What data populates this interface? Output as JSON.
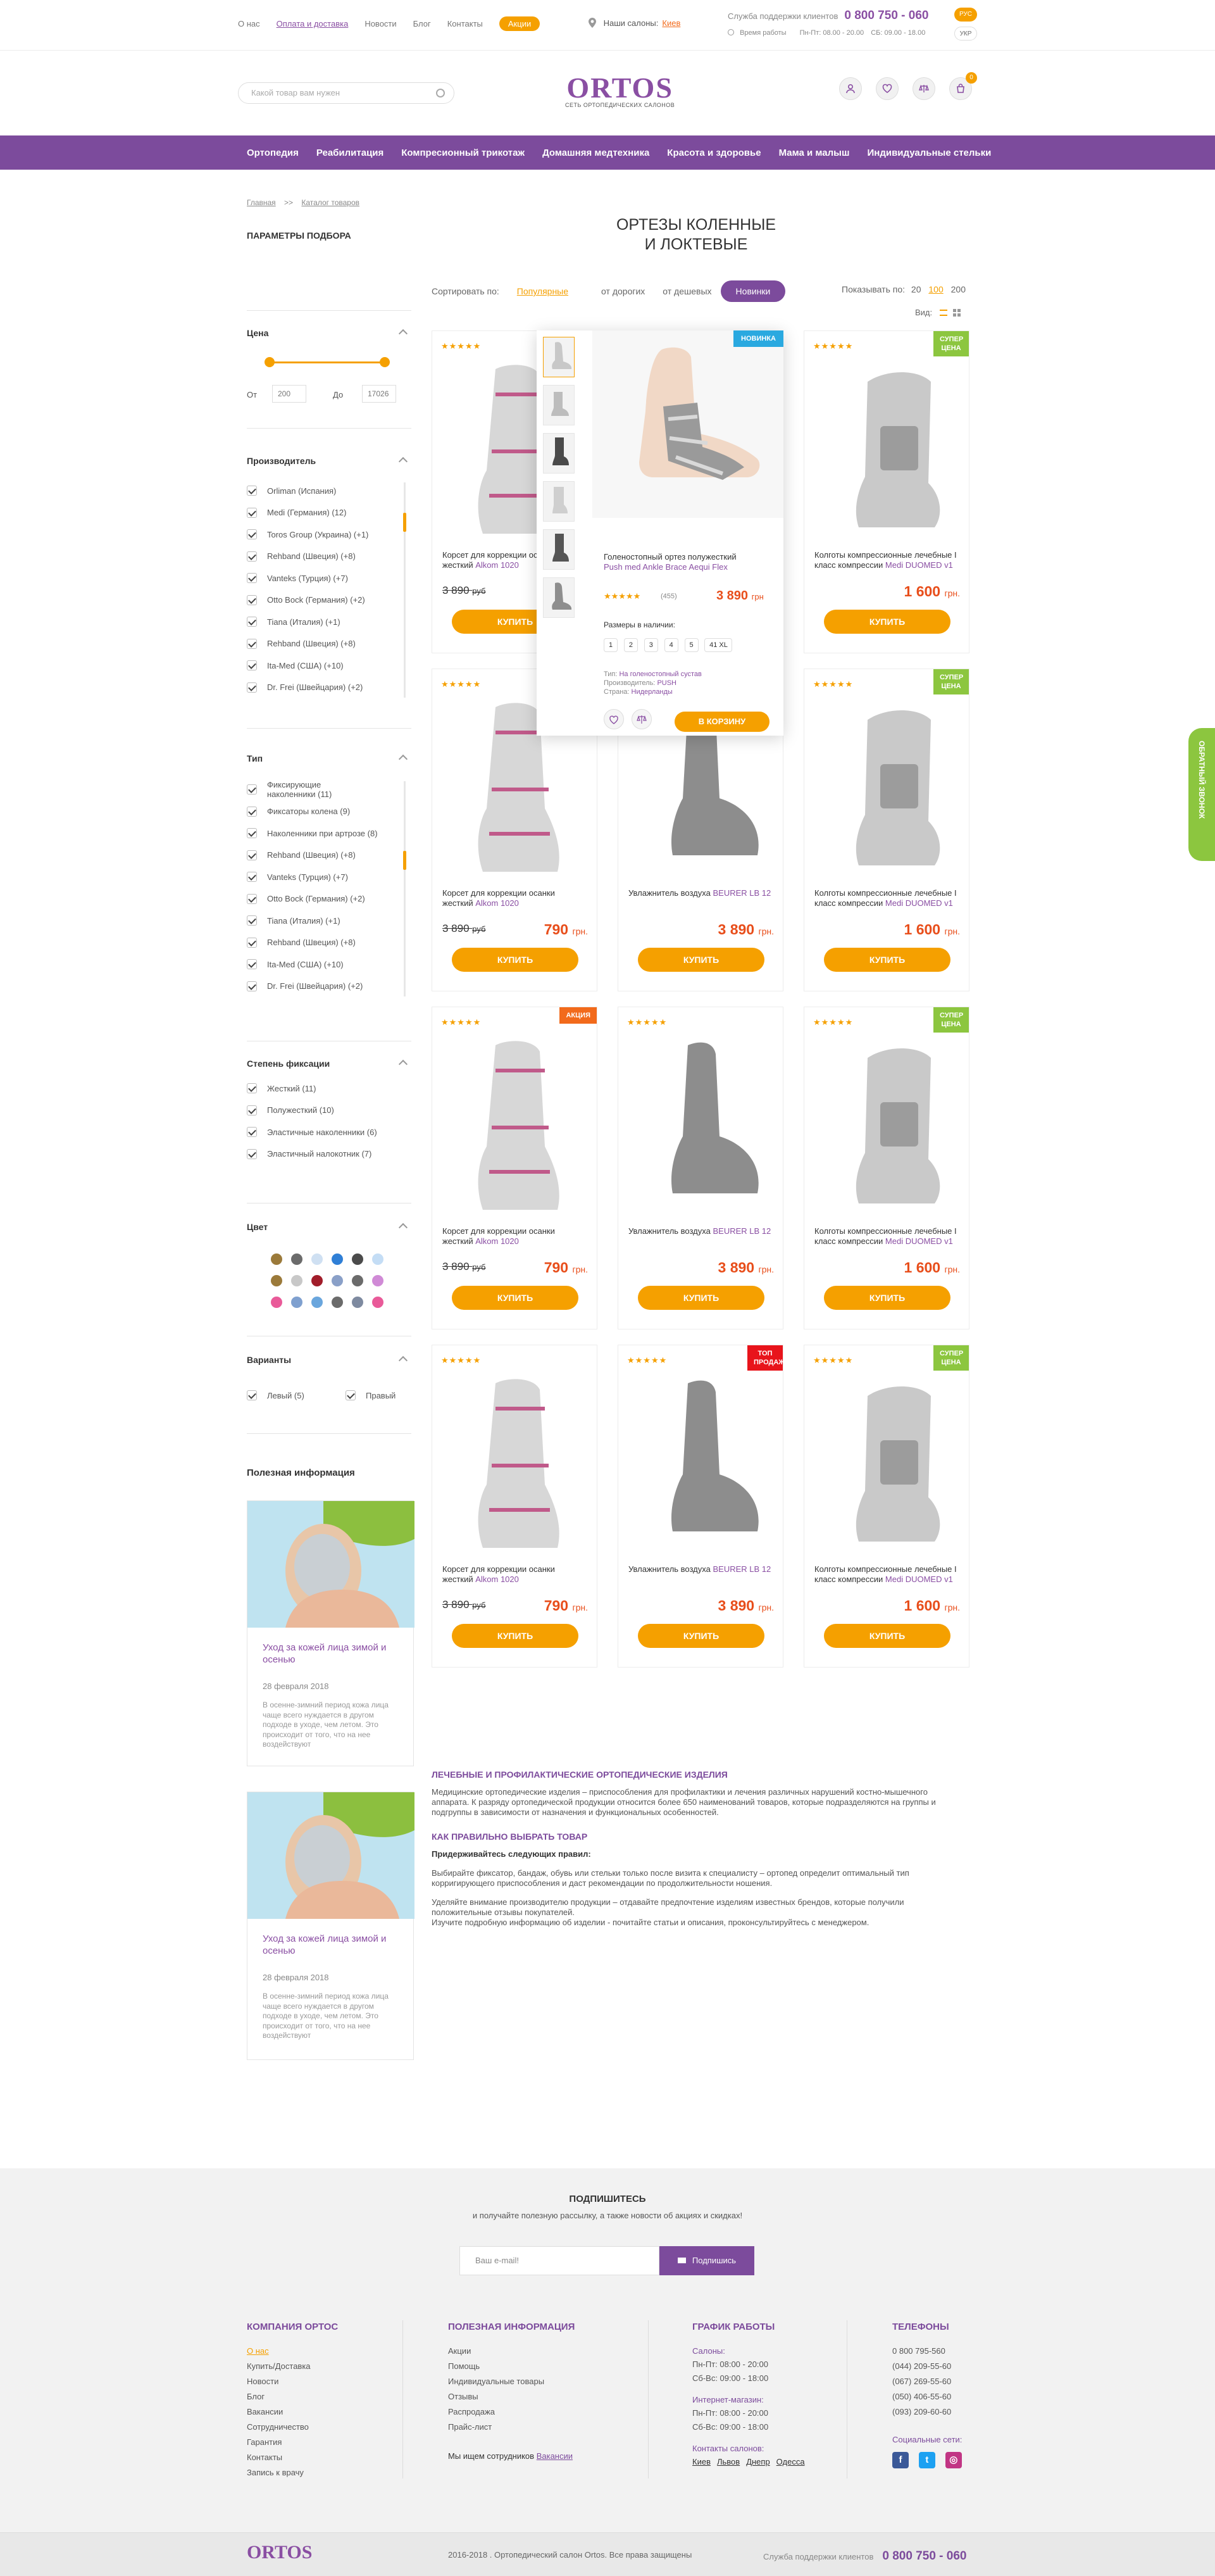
{
  "topnav": {
    "items": [
      "О нас",
      "Оплата и доставка",
      "Новости",
      "Блог",
      "Контакты"
    ],
    "promo": "Акции"
  },
  "salons": {
    "label": "Наши салоны:",
    "city": "Киев"
  },
  "support": {
    "label": "Служба поддержки клиентов",
    "phone": "0 800 750 - 060",
    "hours_label": "Время работы",
    "hours_weekday": "Пн-Пт: 08.00 - 20.00",
    "hours_sat": "СБ: 09.00 - 18.00",
    "lang_ru": "РУС",
    "lang_ua": "УКР"
  },
  "header": {
    "search_placeholder": "Какой товар вам нужен",
    "logo": "ORTOS",
    "logo_tagline": "СЕТЬ ОРТОПЕДИЧЕСКИХ САЛОНОВ",
    "cart_count": "0"
  },
  "mainnav": [
    "Ортопедия",
    "Реабилитация",
    "Компресионный трикотаж",
    "Домашняя медтехника",
    "Красота и здоровье",
    "Мама и малыш",
    "Индивидуальные стельки"
  ],
  "breadcrumbs": {
    "home": "Главная",
    "sep": ">>",
    "current": "Каталог товаров"
  },
  "filters": {
    "title": "ПАРАМЕТРЫ ПОДБОРА",
    "price": {
      "title": "Цена",
      "from_label": "От",
      "from": "200",
      "to_label": "До",
      "to": "17026"
    },
    "maker": {
      "title": "Производитель",
      "items": [
        "Orliman (Испания)",
        "Medi (Германия)  (12)",
        "Toros Group (Украина) (+1)",
        "Rehband (Швеция) (+8)",
        "Vanteks (Турция) (+7)",
        "Otto Bock (Германия) (+2)",
        "Tiana (Италия) (+1)",
        "Rehband (Швеция) (+8)",
        "Ita-Med (США) (+10)",
        "Dr. Frei (Швейцария) (+2)"
      ]
    },
    "type": {
      "title": "Тип",
      "items": [
        "Фиксирующие наколенники (11)",
        "Фиксаторы колена (9)",
        "Наколенники при артрозе (8)",
        "Rehband (Швеция) (+8)",
        "Vanteks (Турция) (+7)",
        "Otto Bock (Германия) (+2)",
        "Tiana (Италия) (+1)",
        "Rehband (Швеция) (+8)",
        "Ita-Med (США) (+10)",
        "Dr. Frei (Швейцария) (+2)"
      ]
    },
    "fixation": {
      "title": "Степень фиксации",
      "items": [
        "Жесткий (11)",
        "Полужесткий (10)",
        "Эластичные наколенники (6)",
        "Эластичный налокотник (7)"
      ]
    },
    "color": {
      "title": "Цвет",
      "swatches": [
        "#9b7a3a",
        "#6b6b6b",
        "#cfe0f2",
        "#2f7fd6",
        "#4b4b4b",
        "#c4ddf5",
        "#9b7a3a",
        "#c8c8c8",
        "#a11d2a",
        "#8aa0c8",
        "#6b6b6b",
        "#d08ad6",
        "#e95a99",
        "#7fa0cf",
        "#6aa6dd",
        "#6b6b6b",
        "#7e8aa0",
        "#e95a99"
      ]
    },
    "variants": {
      "title": "Варианты",
      "left": "Левый (5)",
      "right": "Правый"
    }
  },
  "page": {
    "title_line1": "ОРТЕЗЫ КОЛЕННЫЕ",
    "title_line2": "И ЛОКТЕВЫЕ"
  },
  "sort": {
    "label": "Сортировать по:",
    "popular": "Популярные",
    "expensive": "от дорогих",
    "cheap": "от дешевых",
    "new": "Новинки"
  },
  "show": {
    "label": "Показывать по:",
    "opt1": "20",
    "opt2": "100",
    "opt3": "200",
    "view_label": "Вид:"
  },
  "products": [
    {
      "stars": "★★★★★",
      "badge": "",
      "name": "Корсет для коррекции осанки жесткий",
      "brand": "Alkom 1020",
      "old": "3 890",
      "oldcur": "руб",
      "price": "",
      "cur": "",
      "buy": "КУПИТЬ"
    },
    {
      "stars": "",
      "badge": "НОВИНКА",
      "name": "",
      "brand": "",
      "old": "",
      "oldcur": "",
      "price": "",
      "cur": "",
      "buy": ""
    },
    {
      "stars": "★★★★★",
      "badge": "СУПЕР ЦЕНА",
      "name": "Колготы компрессионные лечебные I класс компрессии",
      "brand": "Medi DUOMED v1",
      "old": "",
      "oldcur": "",
      "price": "1 600",
      "cur": "грн.",
      "buy": "КУПИТЬ"
    },
    {
      "stars": "★★★★★",
      "badge": "",
      "name": "Корсет для коррекции осанки жесткий",
      "brand": "Alkom 1020",
      "old": "3 890",
      "oldcur": "руб",
      "price": "790",
      "cur": "грн.",
      "buy": "КУПИТЬ"
    },
    {
      "stars": "",
      "badge": "",
      "name": "Увлажнитель воздуха",
      "brand": "BEURER LB 12",
      "old": "",
      "oldcur": "",
      "price": "3 890",
      "cur": "грн.",
      "buy": "КУПИТЬ"
    },
    {
      "stars": "★★★★★",
      "badge": "СУПЕР ЦЕНА",
      "name": "Колготы компрессионные лечебные I класс компрессии",
      "brand": "Medi DUOMED v1",
      "old": "",
      "oldcur": "",
      "price": "1 600",
      "cur": "грн.",
      "buy": "КУПИТЬ"
    },
    {
      "stars": "★★★★★",
      "badge": "АКЦИЯ",
      "name": "Корсет для коррекции осанки жесткий",
      "brand": "Alkom 1020",
      "old": "3 890",
      "oldcur": "руб",
      "price": "790",
      "cur": "грн.",
      "buy": "КУПИТЬ"
    },
    {
      "stars": "★★★★★",
      "badge": "",
      "name": "Увлажнитель воздуха",
      "brand": "BEURER LB 12",
      "old": "",
      "oldcur": "",
      "price": "3 890",
      "cur": "грн.",
      "buy": "КУПИТЬ"
    },
    {
      "stars": "★★★★★",
      "badge": "СУПЕР ЦЕНА",
      "name": "Колготы компрессионные лечебные I класс компрессии",
      "brand": "Medi DUOMED v1",
      "old": "",
      "oldcur": "",
      "price": "1 600",
      "cur": "грн.",
      "buy": "КУПИТЬ"
    },
    {
      "stars": "★★★★★",
      "badge": "",
      "name": "Корсет для коррекции осанки жесткий",
      "brand": "Alkom 1020",
      "old": "3 890",
      "oldcur": "руб",
      "price": "790",
      "cur": "грн.",
      "buy": "КУПИТЬ"
    },
    {
      "stars": "★★★★★",
      "badge": "ТОП ПРОДАЖ",
      "name": "Увлажнитель воздуха",
      "brand": "BEURER LB 12",
      "old": "",
      "oldcur": "",
      "price": "3 890",
      "cur": "грн.",
      "buy": "КУПИТЬ"
    },
    {
      "stars": "★★★★★",
      "badge": "СУПЕР ЦЕНА",
      "name": "Колготы компрессионные лечебные I класс компрессии",
      "brand": "Medi DUOMED v1",
      "old": "",
      "oldcur": "",
      "price": "1 600",
      "cur": "грн.",
      "buy": "КУПИТЬ"
    }
  ],
  "popup": {
    "badge": "НОВИНКА",
    "name": "Голеностопный ортез полужесткий",
    "brand": "Push med Ankle Brace Aequi Flex",
    "stars": "★★★★★",
    "reviews": "(455)",
    "price": "3 890",
    "cur": "грн",
    "sizes_label": "Размеры в наличии:",
    "sizes": [
      "1",
      "2",
      "3",
      "4",
      "5",
      "41 XL"
    ],
    "type_label": "Тип:",
    "type": "На голеностопный сустав",
    "maker_label": "Производитель:",
    "maker": "PUSH",
    "country_label": "Страна:",
    "country": "Нидерланды",
    "cart": "В КОРЗИНУ"
  },
  "useful": {
    "title": "Полезная информация",
    "card_title": "Уход за кожей лица зимой и осенью",
    "card_date": "28 февраля 2018",
    "card_text": "В осенне-зимний период кожа лица чаще всего нуждается в другом подходе в уходе, чем летом. Это происходит от того, что на нее воздействуют"
  },
  "seo": {
    "h1": "ЛЕЧЕБНЫЕ И ПРОФИЛАКТИЧЕСКИЕ ОРТОПЕДИЧЕСКИЕ ИЗДЕЛИЯ",
    "p1": "Медицинские ортопедические изделия – приспособления для профилактики и лечения различных нарушений костно-мышечного аппарата. К разряду ортопедической продукции относится более 650 наименований товаров, которые подразделяются на группы и подгруппы в зависимости от назначения и функциональных особенностей.",
    "h2": "КАК ПРАВИЛЬНО ВЫБРАТЬ ТОВАР",
    "rules": "Придерживайтесь следующих правил:",
    "p2": "Выбирайте фиксатор, бандаж, обувь или стельки только после визита к специалисту – ортопед определит оптимальный тип корригирующего приспособления и даст рекомендации по продолжительности ношения.",
    "p3": "Уделяйте внимание производителю продукции – отдавайте предпочтение изделиям известных брендов, которые получили положительные отзывы покупателей.",
    "p4": "Изучите подробную информацию об изделии  - почитайте статьи и описания, проконсультируйтесь с менеджером."
  },
  "subscribe": {
    "title": "ПОДПИШИТЕСЬ",
    "subtitle": "и получайте полезную рассылку, а также новости об акциях и скидках!",
    "placeholder": "Ваш e-mail!",
    "button": "Подпишись"
  },
  "footer": {
    "company": {
      "title": "КОМПАНИЯ ОРТОС",
      "items": [
        "О нас",
        "Купить/Доставка",
        "Новости",
        "Блог",
        "Вакансии",
        "Сотрудничество",
        "Гарантия",
        "Контакты",
        "Запись к врачу"
      ]
    },
    "info": {
      "title": "ПОЛЕЗНАЯ ИНФОРМАЦИЯ",
      "items": [
        "Акции",
        "Помощь",
        "Индивидуальные товары",
        "Отзывы",
        "Распродажа",
        "Прайс-лист"
      ],
      "hiring": "Мы ищем сотрудников",
      "vacancies": "Вакансии"
    },
    "schedule": {
      "title": "ГРАФИК РАБОТЫ",
      "salons_label": "Салоны:",
      "s1": "Пн-Пт: 08:00 - 20:00",
      "s2": "Сб-Вс: 09:00 - 18:00",
      "shop_label": "Интернет-магазин:",
      "m1": "Пн-Пт: 08:00 - 20:00",
      "m2": "Сб-Вс: 09:00 - 18:00",
      "contacts_label": "Контакты салонов:",
      "cities": [
        "Киев",
        "Львов",
        "Днепр",
        "Одесса"
      ]
    },
    "phones": {
      "title": "ТЕЛЕФОНЫ",
      "items": [
        "0 800 795-560",
        "(044)  209-55-60",
        "(067)  269-55-60",
        "(050)  406-55-60",
        "(093)  209-60-60"
      ],
      "social_label": "Социальные сети:"
    },
    "copyright": "2016-2018 . Ортопедический салон Ortos. Все права защищены",
    "support_label": "Служба поддержки клиентов",
    "support_phone": "0 800 750 - 060"
  },
  "callback": "ОБРАТНЫЙ ЗВОНОК",
  "colors": {
    "brand": "#7c4b9c",
    "accent": "#f5a000",
    "price": "#e84e1b",
    "new_badge": "#2aa9e0",
    "super_badge": "#8cc63f",
    "promo_badge": "#f26a1b",
    "top_badge": "#e8141b"
  }
}
